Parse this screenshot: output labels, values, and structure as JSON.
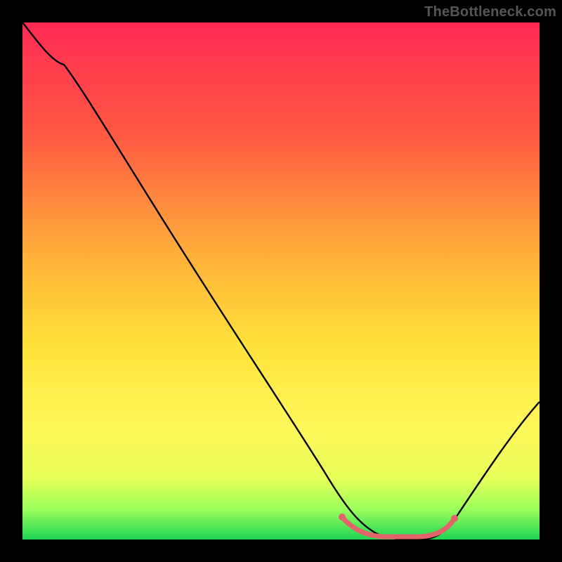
{
  "watermark": "TheBottleneck.com",
  "colors": {
    "bg": "#000000",
    "grad_top": "#ff2a55",
    "grad_mid1": "#ff6a3a",
    "grad_mid2": "#ffd23a",
    "grad_mid3": "#fff05a",
    "grad_bottom": "#1fd655",
    "curve": "#000000",
    "marker": "#e2636a"
  },
  "chart_data": {
    "type": "line",
    "title": "",
    "xlabel": "",
    "ylabel": "",
    "xlim": [
      0,
      100
    ],
    "ylim": [
      0,
      100
    ],
    "series": [
      {
        "name": "curve",
        "x": [
          0,
          3,
          8,
          15,
          25,
          35,
          45,
          53,
          58,
          62,
          66,
          70,
          74,
          79,
          85,
          92,
          100
        ],
        "y": [
          100,
          97,
          92,
          84,
          71,
          58,
          44,
          32,
          23,
          14,
          6,
          1,
          0,
          0,
          5,
          14,
          27
        ]
      },
      {
        "name": "flat-bottom-marker",
        "x": [
          62,
          66,
          70,
          74,
          79,
          83
        ],
        "y": [
          4,
          1,
          0,
          0,
          1,
          4
        ]
      }
    ],
    "annotations": []
  }
}
